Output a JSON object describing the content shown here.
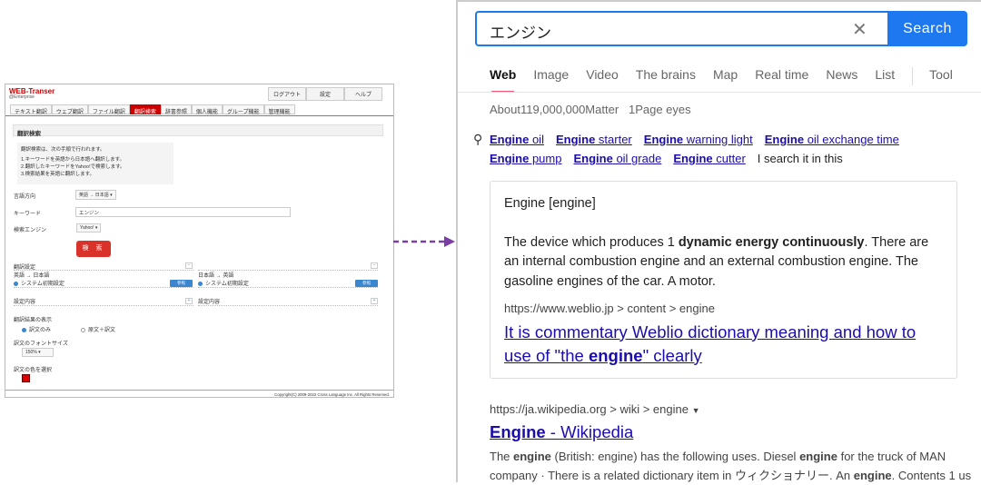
{
  "app": {
    "logo": "WEB-Transer",
    "logo_sub": "@Enterprise",
    "top_buttons": [
      "ログアウト",
      "設定",
      "ヘルプ"
    ],
    "tabs": [
      "テキスト翻訳",
      "ウェブ翻訳",
      "ファイル翻訳",
      "翻訳検索",
      "辞書参照",
      "個人機能",
      "グループ機能",
      "管理機能"
    ],
    "active_tab": "翻訳検索",
    "section_title": "翻訳検索",
    "info": [
      "翻訳検索は、次の手順で行われます。",
      "1.キーワードを英語から日本語へ翻訳します。",
      "2.翻訳したキーワードをYahoo!で検索します。",
      "3.検索結果を英語に翻訳します。"
    ],
    "direction_label": "言語方向",
    "direction_value": "英語 → 日本語",
    "keyword_label": "キーワード",
    "keyword_value": "エンジン",
    "engine_label": "検索エンジン",
    "engine_value": "Yahoo!",
    "search_button": "検 索",
    "settings_title": "翻訳設定",
    "left_pair": "英語 → 日本語",
    "right_pair": "日本語 → 英語",
    "system_default": "システム初期設定",
    "ref_button": "参照",
    "settings_content": "設定内容",
    "display_label": "翻訳結果の表示",
    "display_opt1": "訳文のみ",
    "display_opt2": "原文＋訳文",
    "font_size_label": "訳文のフォントサイズ",
    "font_size_value": "150%",
    "color_label": "訳文の色を選択",
    "color_value": "#e00000",
    "copyright": "Copyright(C) 2009-2022 Cross Language Inc. All Rights Reserved."
  },
  "search": {
    "query": "エンジン",
    "button": "Search",
    "accent": "#1e78f0",
    "nav": [
      "Web",
      "Image",
      "Video",
      "The brains",
      "Map",
      "Real time",
      "News",
      "List"
    ],
    "tool": "Tool",
    "count": "About119,000,000Matter   1Page eyes",
    "suggestions": [
      [
        "Engine",
        " oil"
      ],
      [
        "Engine",
        " starter"
      ],
      [
        "Engine",
        " warning light"
      ],
      [
        "Engine",
        " oil exchange time"
      ],
      [
        "Engine",
        " pump"
      ],
      [
        "Engine",
        " oil grade"
      ],
      [
        "Engine",
        " cutter"
      ]
    ],
    "suggest_tail": "I search it in this",
    "card": {
      "heading": "Engine [engine]",
      "body": [
        {
          "t": "The device which produces 1 "
        },
        {
          "t": "dynamic energy continuously",
          "b": 1
        },
        {
          "t": ". There are an internal combustion engine and an external combustion engine. The gasoline engines of the car. A motor."
        }
      ],
      "url": "https://www.weblio.jp > content >  engine",
      "title": [
        {
          "t": "It is commentary Weblio dictionary meaning and how to use of \"the "
        },
        {
          "t": "engine",
          "b": 1
        },
        {
          "t": "\" clearly"
        }
      ]
    },
    "result2": {
      "url": "https://ja.wikipedia.org > wiki >  engine",
      "title": [
        {
          "t": "Engine",
          "b": 1
        },
        {
          "t": " - Wikipedia"
        }
      ],
      "snippet": [
        {
          "t": "The "
        },
        {
          "t": "engine",
          "b": 1
        },
        {
          "t": " (British: engine) has the following uses. Diesel "
        },
        {
          "t": "engine",
          "b": 1
        },
        {
          "t": " for the truck of MAN company · There is a related dictionary item in ウィクショナリー. An "
        },
        {
          "t": "engine",
          "b": 1
        },
        {
          "t": ". Contents 1 us"
        }
      ]
    }
  }
}
